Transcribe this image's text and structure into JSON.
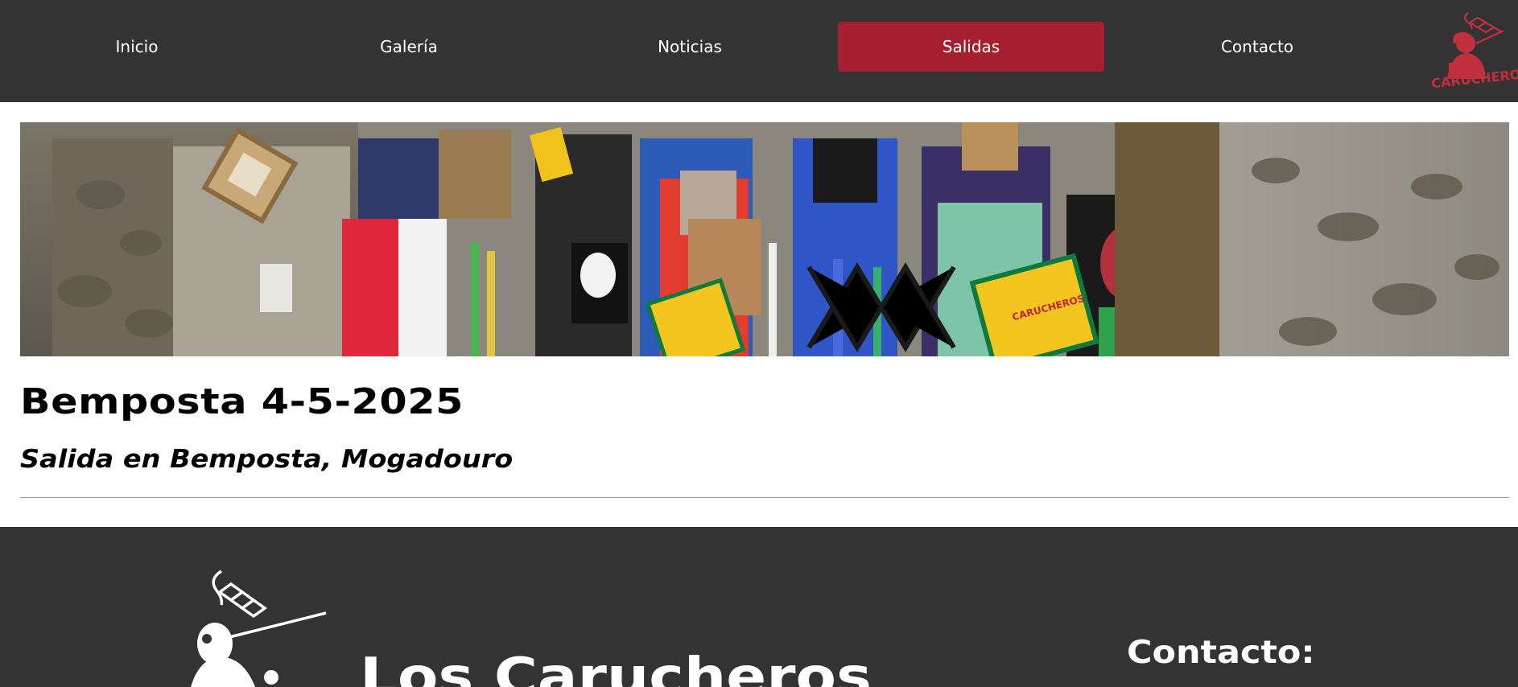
{
  "nav": {
    "items": [
      {
        "label": "Inicio",
        "active": false
      },
      {
        "label": "Galería",
        "active": false
      },
      {
        "label": "Noticias",
        "active": false
      },
      {
        "label": "Salidas",
        "active": true
      },
      {
        "label": "Contacto",
        "active": false
      }
    ],
    "logo_text": "CARUCHEROS"
  },
  "main": {
    "title": "Bemposta 4-5-2025",
    "subtitle": "Salida en Bemposta, Mogadouro",
    "hero_banner_text": "CARUCHEROS"
  },
  "footer": {
    "brand": "Los Carucheros",
    "contact_heading": "Contacto:"
  },
  "colors": {
    "nav_bg": "#333333",
    "accent": "#a61f30",
    "footer_bg": "#333333"
  }
}
